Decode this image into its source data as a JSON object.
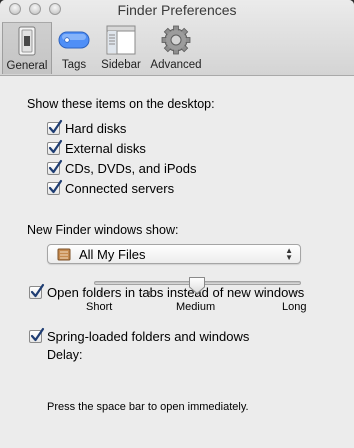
{
  "window": {
    "title": "Finder Preferences"
  },
  "toolbar": {
    "tabs": [
      {
        "label": "General",
        "icon": "general-switch-icon",
        "selected": true
      },
      {
        "label": "Tags",
        "icon": "tag-icon",
        "selected": false
      },
      {
        "label": "Sidebar",
        "icon": "sidebar-icon",
        "selected": false
      },
      {
        "label": "Advanced",
        "icon": "gear-icon",
        "selected": false
      }
    ]
  },
  "desktop": {
    "heading": "Show these items on the desktop:",
    "items": [
      {
        "label": "Hard disks",
        "checked": true
      },
      {
        "label": "External disks",
        "checked": true
      },
      {
        "label": "CDs, DVDs, and iPods",
        "checked": true
      },
      {
        "label": "Connected servers",
        "checked": true
      }
    ]
  },
  "new_window": {
    "heading": "New Finder windows show:",
    "selected": "All My Files",
    "icon": "all-my-files-icon"
  },
  "tabs_option": {
    "label": "Open folders in tabs instead of new windows",
    "checked": true
  },
  "spring": {
    "label": "Spring-loaded folders and windows",
    "checked": true,
    "delay_label": "Delay:",
    "slider_labels": [
      "Short",
      "Medium",
      "Long"
    ],
    "slider_value": "Medium",
    "note": "Press the space bar to open immediately."
  },
  "colors": {
    "window_bg": "#ececec",
    "toolbar_bg": "#d4d4d4",
    "tags_blue": "#4f8ff7",
    "check": "#1f3d73"
  }
}
